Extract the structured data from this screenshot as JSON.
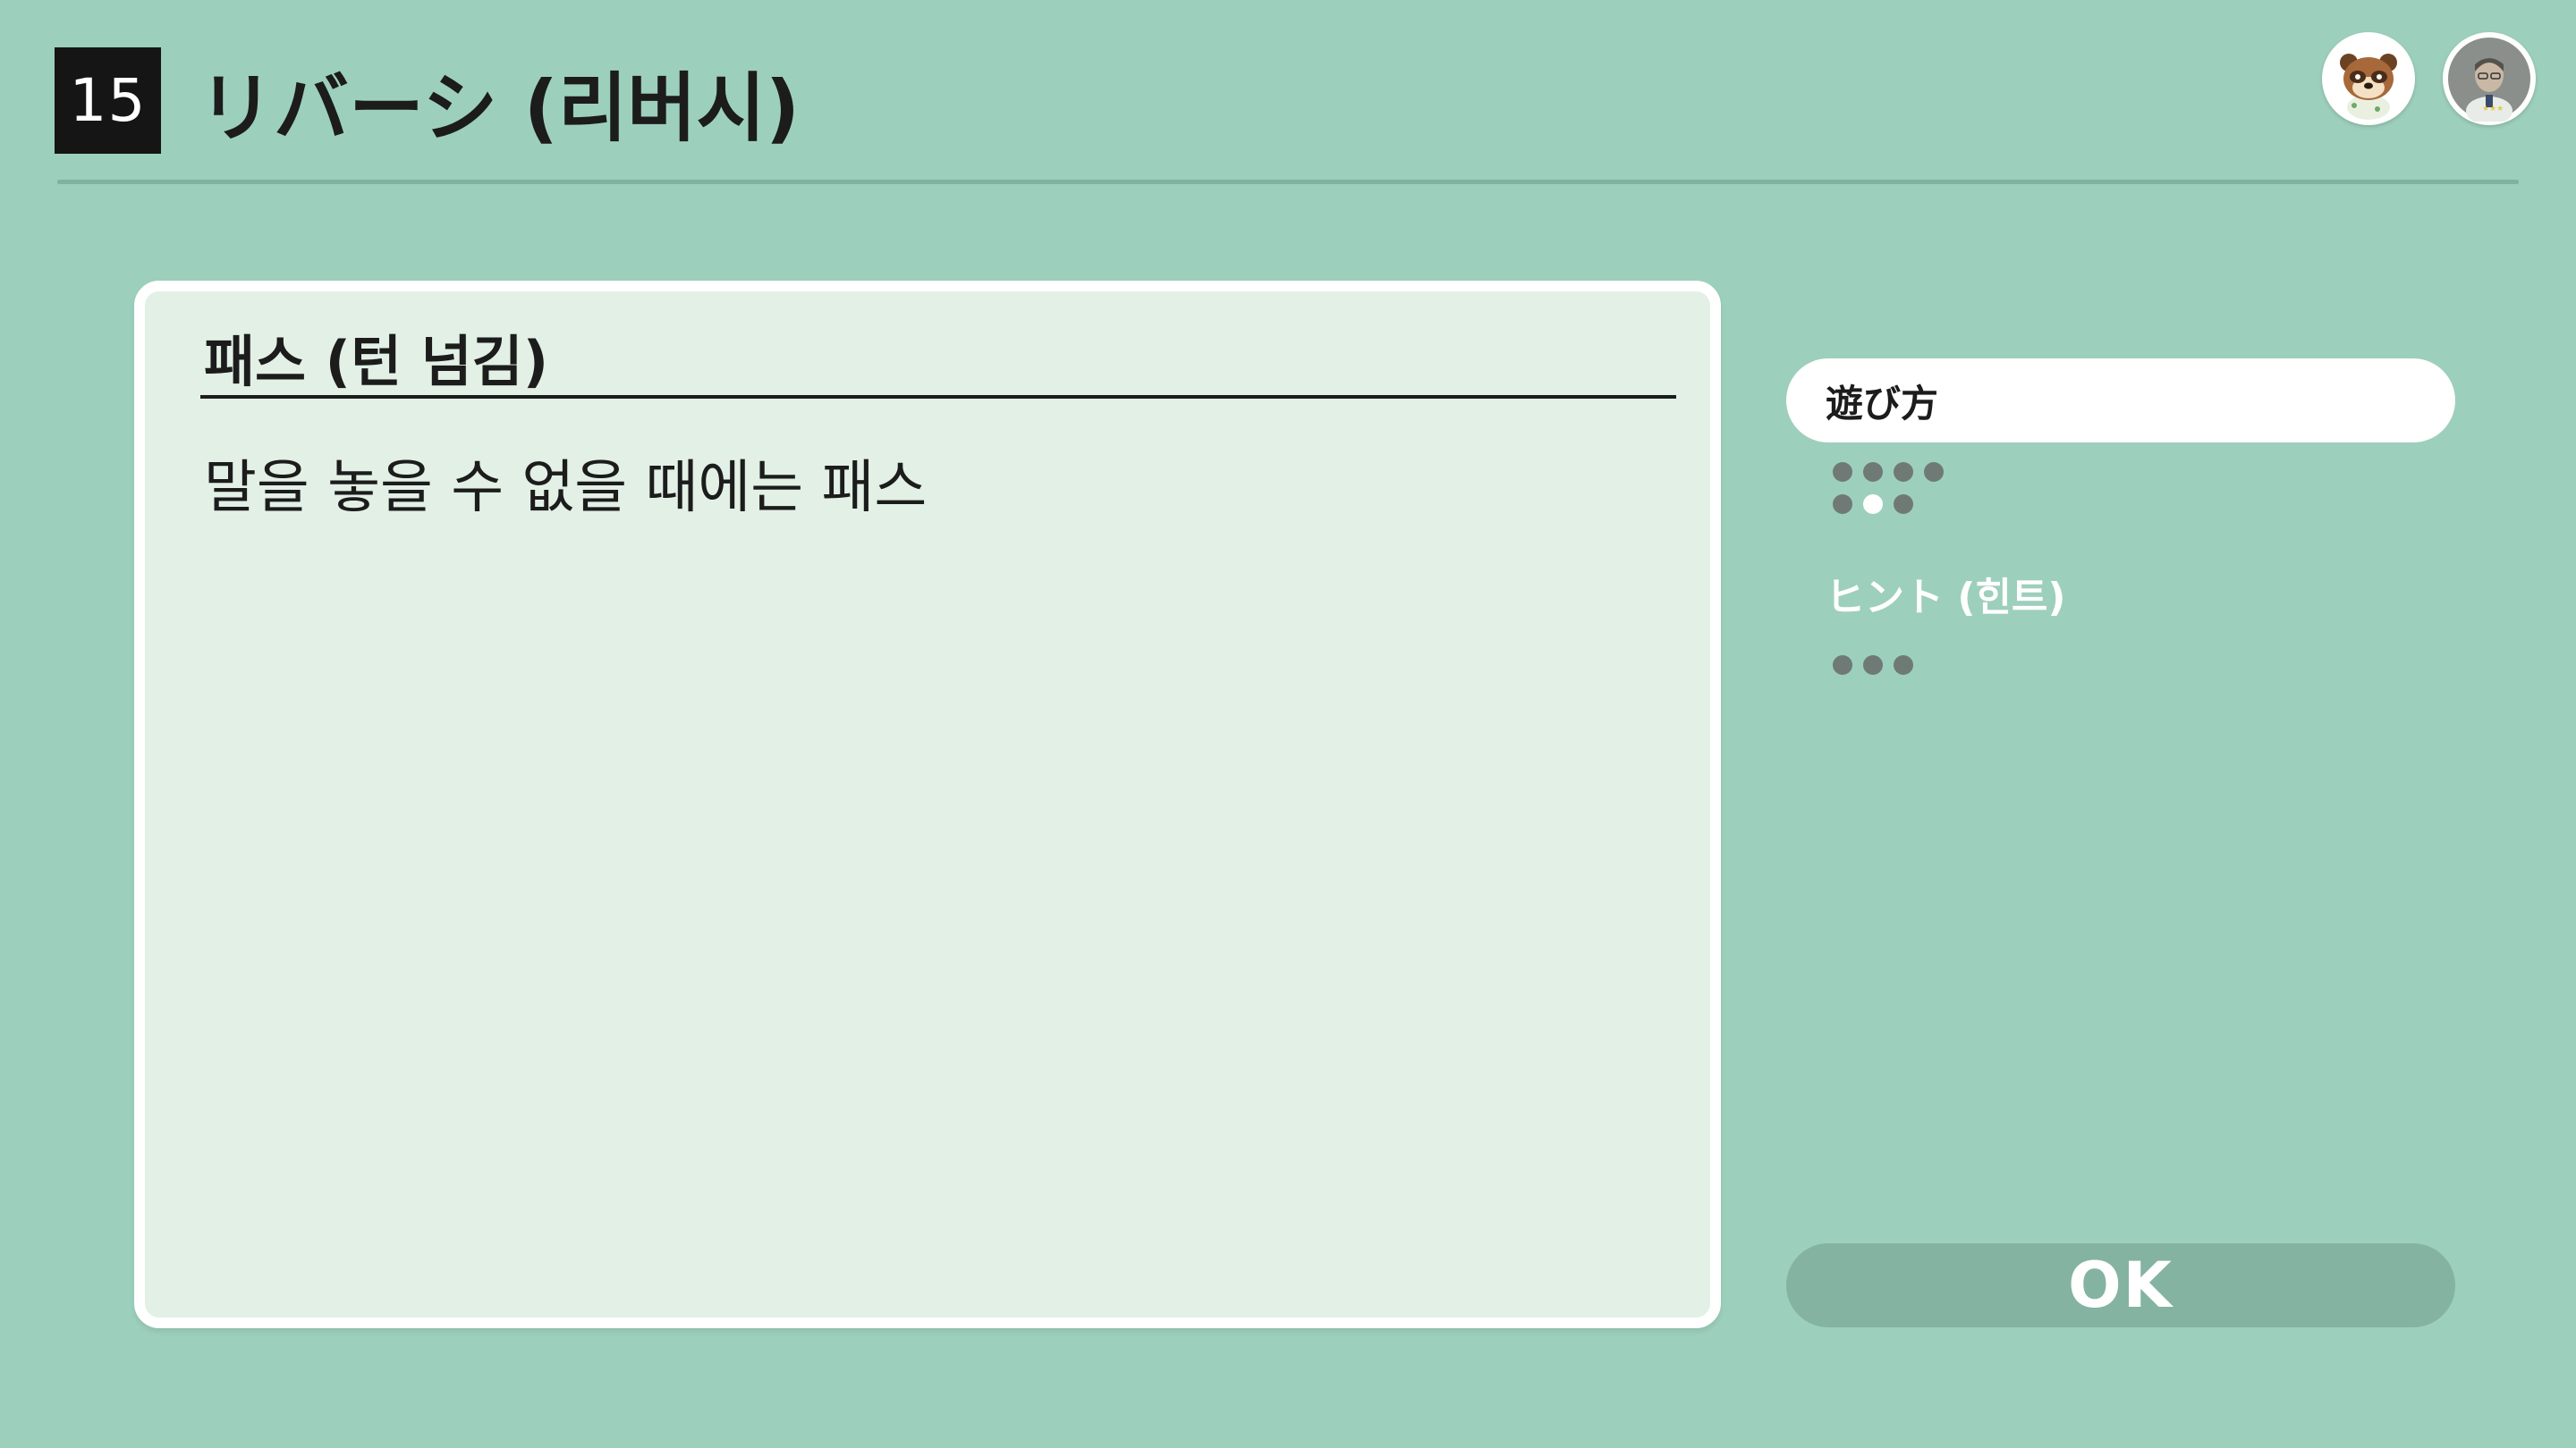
{
  "header": {
    "number": "15",
    "title": "リバーシ (리버시)",
    "avatars": [
      {
        "name": "raccoon-character-avatar"
      },
      {
        "name": "player-avatar"
      }
    ]
  },
  "panel": {
    "title": "패스 (턴 넘김)",
    "body": "말을 놓을 수 없을 때에는 패스"
  },
  "menu": {
    "items": [
      {
        "label": "遊び方",
        "active": true,
        "pages": 7,
        "current_page": 6
      },
      {
        "label": "ヒント (힌트)",
        "active": false,
        "pages": 3,
        "current_page": 0
      }
    ]
  },
  "footer": {
    "ok_label": "OK"
  },
  "colors": {
    "background": "#9dcfbd",
    "panel_bg": "#e2f0e6",
    "ok_button": "#84b3a2",
    "dot": "#6f7a76"
  }
}
